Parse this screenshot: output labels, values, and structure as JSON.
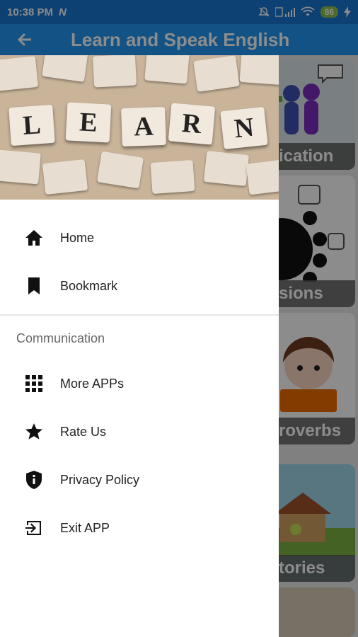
{
  "status_bar": {
    "time": "10:38 PM",
    "network_letter": "N",
    "battery": "86"
  },
  "app_bar": {
    "title": "Learn and Speak English",
    "back_icon": "arrow-left-icon"
  },
  "drawer": {
    "header_letters": [
      "L",
      "E",
      "A",
      "R",
      "N"
    ],
    "primary_items": [
      {
        "label": "Home",
        "icon": "home-icon"
      },
      {
        "label": "Bookmark",
        "icon": "bookmark-icon"
      }
    ],
    "section_title": "Communication",
    "secondary_items": [
      {
        "label": "More APPs",
        "icon": "apps-grid-icon"
      },
      {
        "label": "Rate Us",
        "icon": "star-icon"
      },
      {
        "label": "Privacy Policy",
        "icon": "shield-icon"
      },
      {
        "label": "Exit APP",
        "icon": "exit-icon"
      }
    ]
  },
  "background_cards": [
    {
      "label": "ication"
    },
    {
      "label": "sions"
    },
    {
      "label": "roverbs"
    },
    {
      "label": "tories"
    }
  ],
  "colors": {
    "status_bar": "#1976d2",
    "app_bar": "#2196f3",
    "battery": "#8bc34a"
  }
}
